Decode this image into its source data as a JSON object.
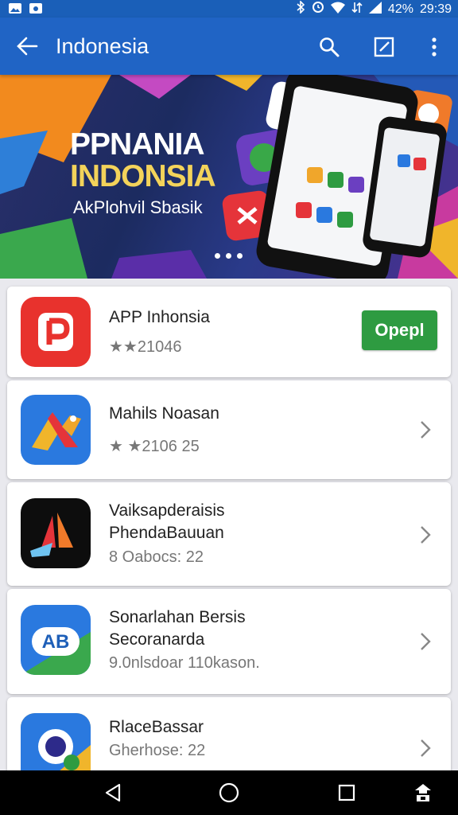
{
  "status_bar": {
    "battery": "42%",
    "time": "29:39",
    "icons": [
      "image-icon",
      "photo-icon",
      "bluetooth-icon",
      "alarm-icon",
      "wifi-icon",
      "data-icon",
      "signal-icon"
    ]
  },
  "app_bar": {
    "title": "Indonesia",
    "icons": [
      "back-arrow-icon",
      "search-icon",
      "edit-icon",
      "more-vert-icon"
    ]
  },
  "banner": {
    "line1": "PPNANIA",
    "line2": "INDONSIA",
    "line3": "AkPlohvil Sbasik",
    "page_dots": 3
  },
  "apps": [
    {
      "name": "APP Inhonsia",
      "meta": "★★21046",
      "action": "Opepl"
    },
    {
      "name": "Mahils Noasan",
      "meta": "★ ★2106  25"
    },
    {
      "name": "Vaiksapderaisis",
      "name2": "PhendaBauuan",
      "meta": "8 Oabocs:  22"
    },
    {
      "name": "Sonarlahan Bersis",
      "name2": "Secoranarda",
      "meta": "9.0nlsdoar  110kason."
    },
    {
      "name": "RlaceBassar",
      "meta": "Gherhose:  22"
    }
  ],
  "colors": {
    "app_bar": "#2064c5",
    "status_bar": "#1a5fb8",
    "open_button": "#2e9b41",
    "star": "#e8b923",
    "star_pink": "#c95fb7"
  },
  "nav_bar": {
    "icons": [
      "back-triangle-icon",
      "home-circle-icon",
      "recents-square-icon",
      "share-icon"
    ]
  }
}
